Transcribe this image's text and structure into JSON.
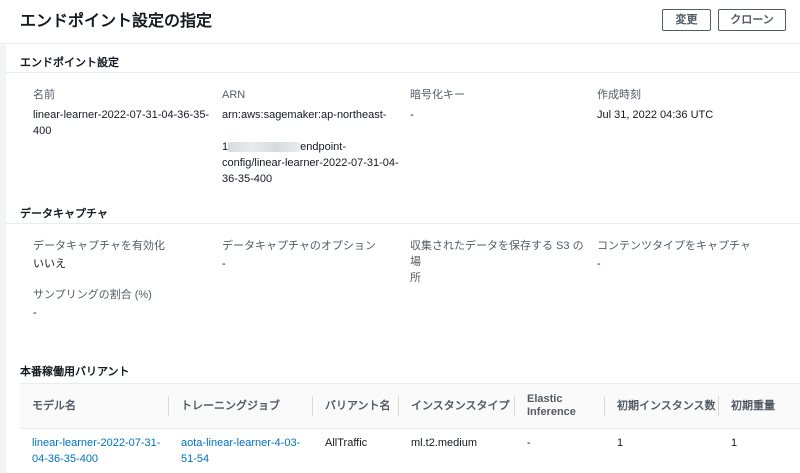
{
  "header": {
    "title": "エンドポイント設定の指定",
    "edit_label": "変更",
    "clone_label": "クローン"
  },
  "endpoint_config": {
    "section_title": "エンドポイント設定",
    "name_label": "名前",
    "name_value": "linear-learner-2022-07-31-04-36-35-\n400",
    "arn_label": "ARN",
    "arn_line1": "arn:aws:sagemaker:ap-northeast-",
    "arn_line2_prefix": "1",
    "arn_line2_suffix": "endpoint-",
    "arn_line3": "config/linear-learner-2022-07-31-04-\n36-35-400",
    "encryption_label": "暗号化キー",
    "encryption_value": "-",
    "created_label": "作成時刻",
    "created_value": "Jul 31, 2022 04:36 UTC"
  },
  "data_capture": {
    "section_title": "データキャプチャ",
    "enable_label": "データキャプチャを有効化",
    "enable_value": "いいえ",
    "options_label": "データキャプチャのオプション",
    "options_value": "-",
    "s3_label": "収集されたデータを保存する S3 の場\n所",
    "s3_value": "",
    "content_type_label": "コンテンツタイプをキャプチャ",
    "content_type_value": "-",
    "sampling_label": "サンプリングの割合 (%)",
    "sampling_value": "-"
  },
  "variants": {
    "section_title": "本番稼働用バリアント",
    "columns": [
      "モデル名",
      "トレーニングジョブ",
      "バリアント名",
      "インスタンスタイプ",
      "Elastic\nInference",
      "初期インスタンス数",
      "初期重量"
    ],
    "rows": [
      {
        "model_name": "linear-learner-2022-07-31-\n04-36-35-400",
        "training_job": "aota-linear-learner-4-03-\n51-54",
        "variant_name": "AllTraffic",
        "instance_type": "ml.t2.medium",
        "elastic_inference": "-",
        "initial_instance_count": "1",
        "initial_weight": "1"
      }
    ]
  }
}
